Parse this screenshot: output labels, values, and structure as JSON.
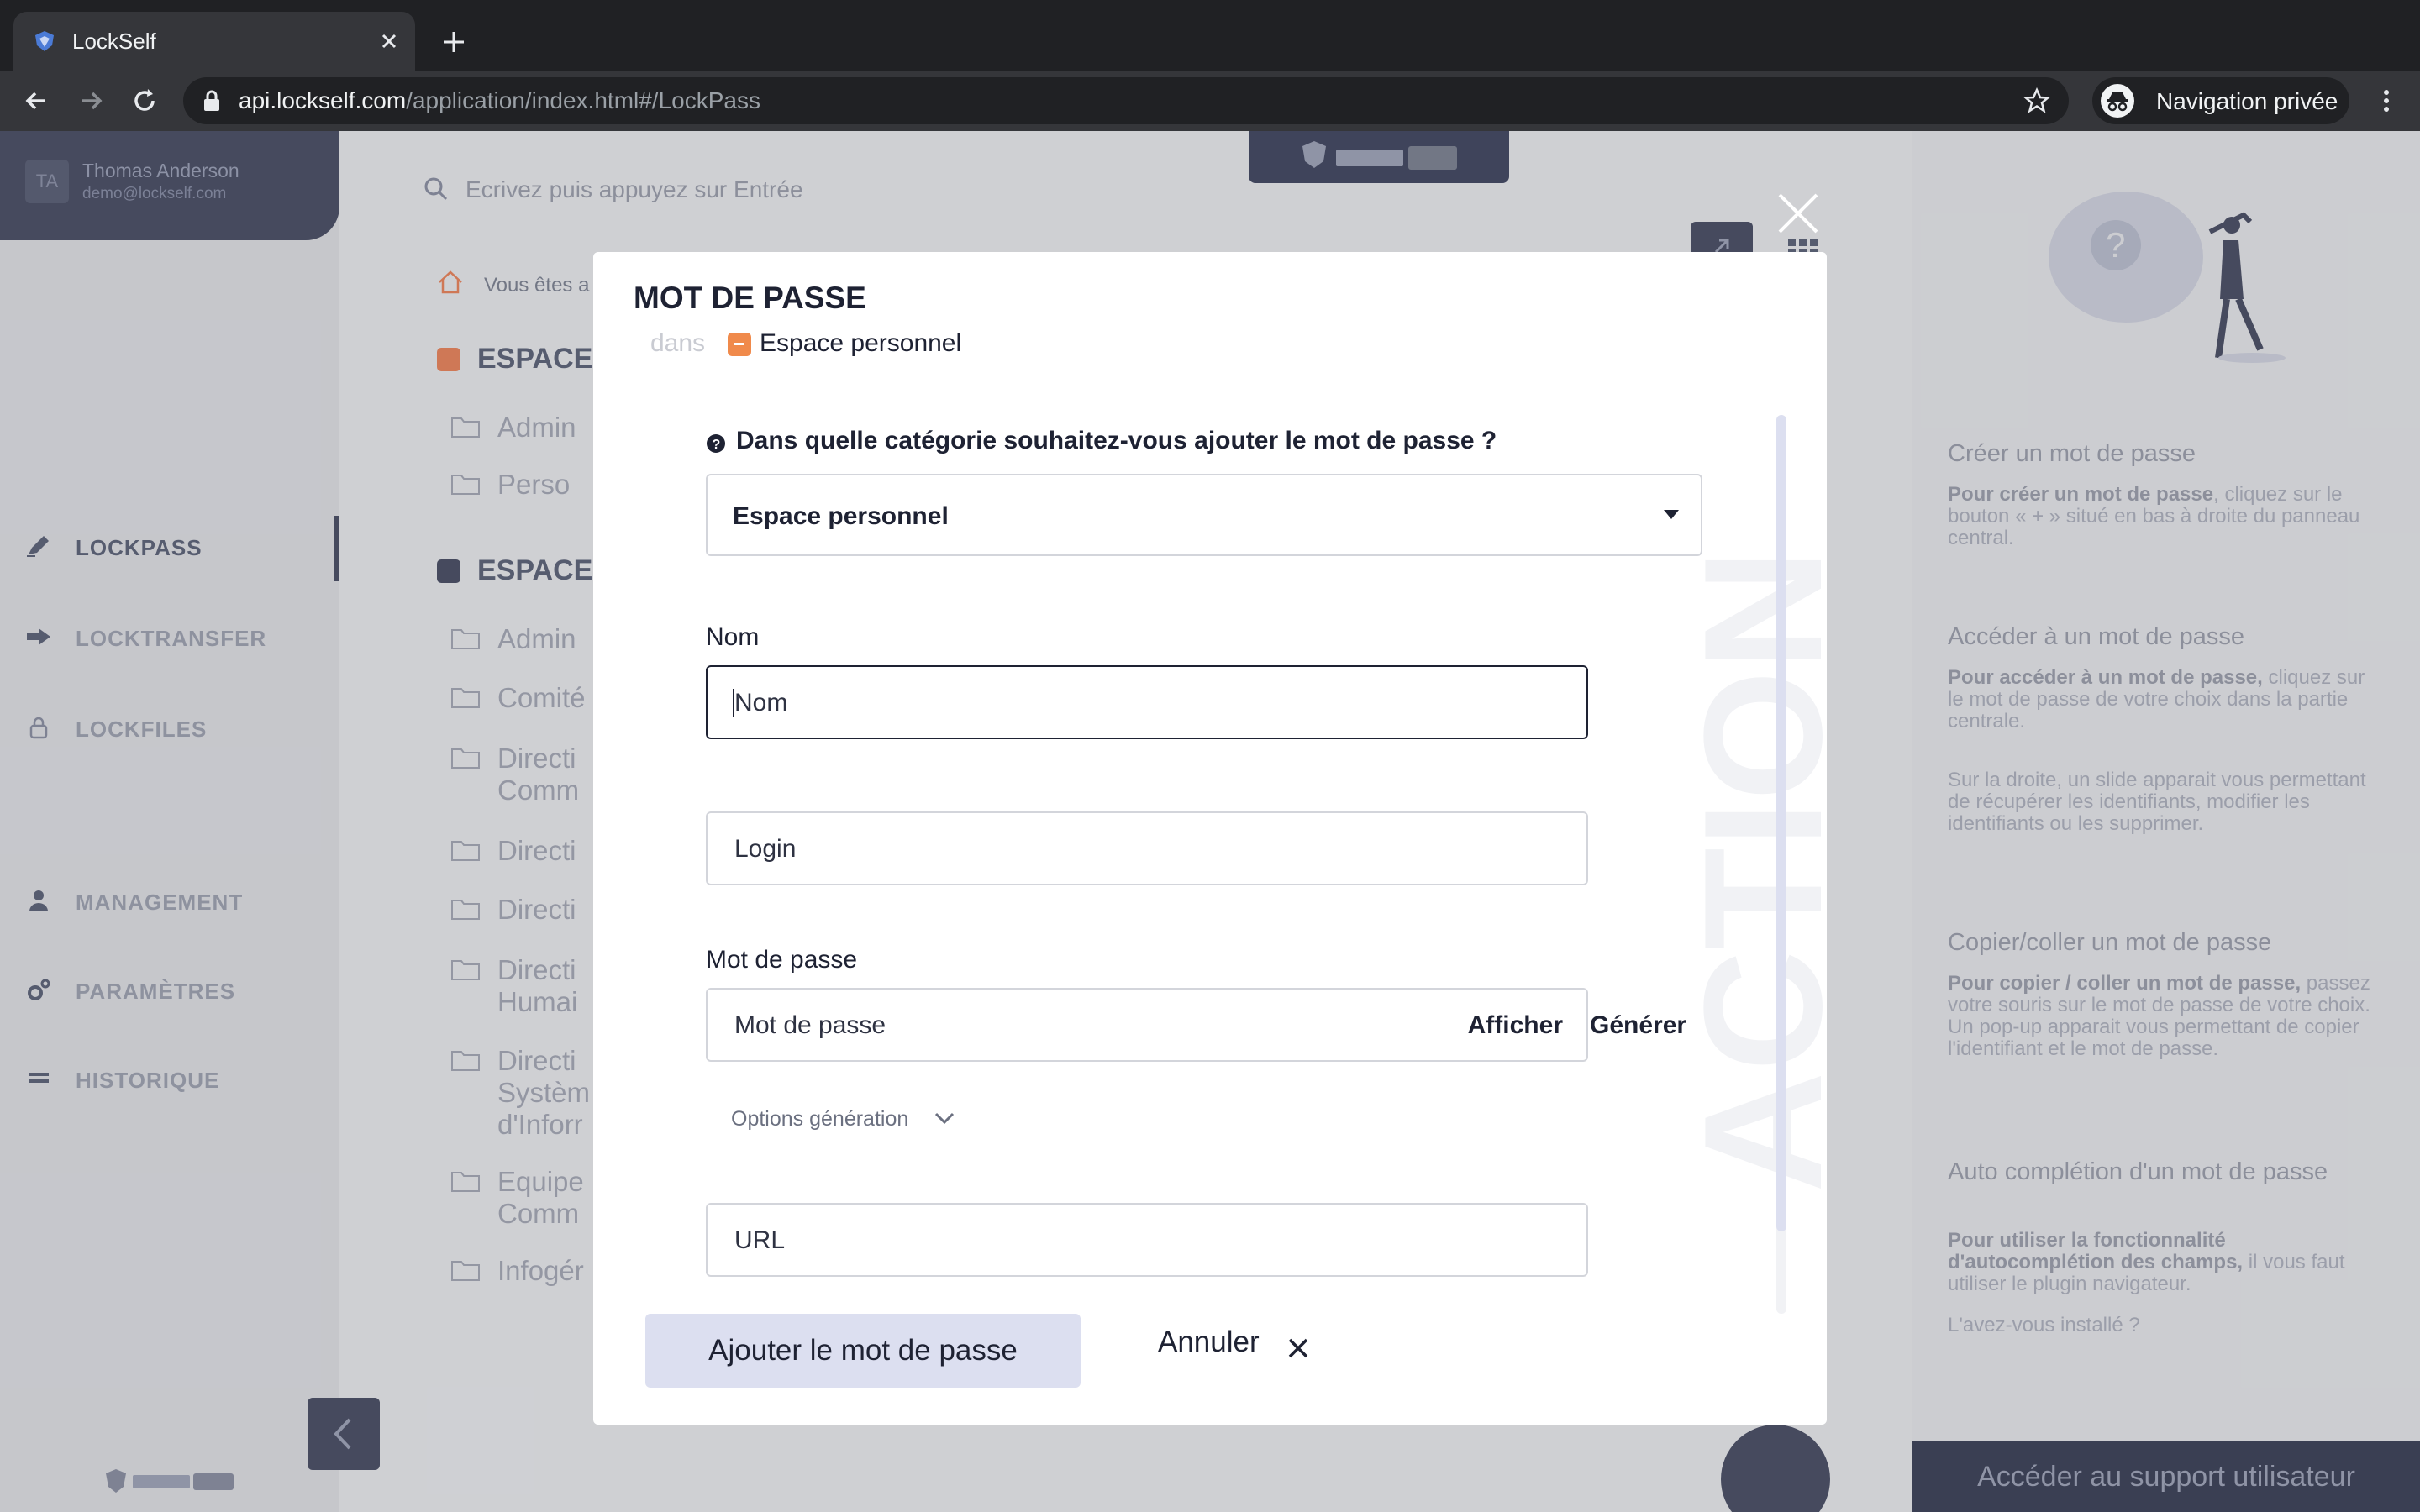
{
  "browser": {
    "tab_title": "LockSelf",
    "url_host": "api.lockself.com",
    "url_path": "/application/index.html#/LockPass",
    "incognito_label": "Navigation privée"
  },
  "sidebar": {
    "user_initials": "TA",
    "user_name": "Thomas Anderson",
    "user_email": "demo@lockself.com",
    "items": [
      {
        "label": "LOCKPASS",
        "icon": "pen-icon",
        "active": true
      },
      {
        "label": "LOCKTRANSFER",
        "icon": "arrow-right-icon",
        "active": false
      },
      {
        "label": "LOCKFILES",
        "icon": "lock-icon",
        "active": false
      },
      {
        "label": "MANAGEMENT",
        "icon": "user-icon",
        "active": false
      },
      {
        "label": "PARAMÈTRES",
        "icon": "gears-icon",
        "active": false
      },
      {
        "label": "HISTORIQUE",
        "icon": "lines-icon",
        "active": false
      }
    ]
  },
  "main": {
    "search_placeholder": "Ecrivez puis appuyez sur Entrée",
    "breadcrumb": "Vous êtes a",
    "space_1": "ESPACE",
    "space_2": "ESPACE",
    "folders": [
      "Admin",
      "Perso",
      "Admin",
      "Comité",
      "Directi Comm",
      "Directi",
      "Directi",
      "Directi Humai",
      "Directi Systèm d'Inforr",
      "Equipe Comm",
      "Infogér"
    ]
  },
  "help": {
    "sections": [
      {
        "title": "Créer un mot de passe",
        "bold": "Pour créer un mot de passe",
        "text": ", cliquez sur le bouton « + » situé en bas à droite du panneau central."
      },
      {
        "title": "Accéder à un mot de passe",
        "bold": "Pour accéder à un mot de passe,",
        "text": " cliquez sur le mot de passe de votre choix dans la partie centrale."
      },
      {
        "title": "",
        "bold": "",
        "text": "Sur la droite, un slide apparait vous permettant de récupérer les identifiants, modifier les identifiants ou les supprimer."
      },
      {
        "title": "Copier/coller un mot de passe",
        "bold": "Pour copier / coller un mot de passe,",
        "text": " passez votre souris sur le mot de passe de votre choix. Un pop-up apparait vous permettant de copier l'identifiant et le mot de passe."
      },
      {
        "title": "Auto complétion d'un mot de passe",
        "bold": "Pour utiliser la fonctionnalité d'autocomplétion des champs,",
        "text": " il vous faut utiliser le plugin navigateur."
      }
    ],
    "link": "L'avez-vous installé ?",
    "support_button": "Accéder au support utilisateur"
  },
  "modal": {
    "title": "MOT DE PASSE",
    "in_label": "dans",
    "space_name": "Espace personnel",
    "question": "Dans quelle catégorie souhaitez-vous ajouter le mot de passe ?",
    "category_value": "Espace personnel",
    "name_label": "Nom",
    "name_placeholder": "Nom",
    "login_placeholder": "Login",
    "password_label": "Mot de passe",
    "password_placeholder": "Mot de passe",
    "show_label": "Afficher",
    "generate_label": "Générer",
    "options_label": "Options génération",
    "url_placeholder": "URL",
    "add_button": "Ajouter le mot de passe",
    "cancel_button": "Annuler",
    "watermark": "ACTION"
  },
  "colors": {
    "brand_dark": "#4a4f63",
    "accent_orange": "#f08a4b",
    "primary_button": "#dcdff0"
  }
}
